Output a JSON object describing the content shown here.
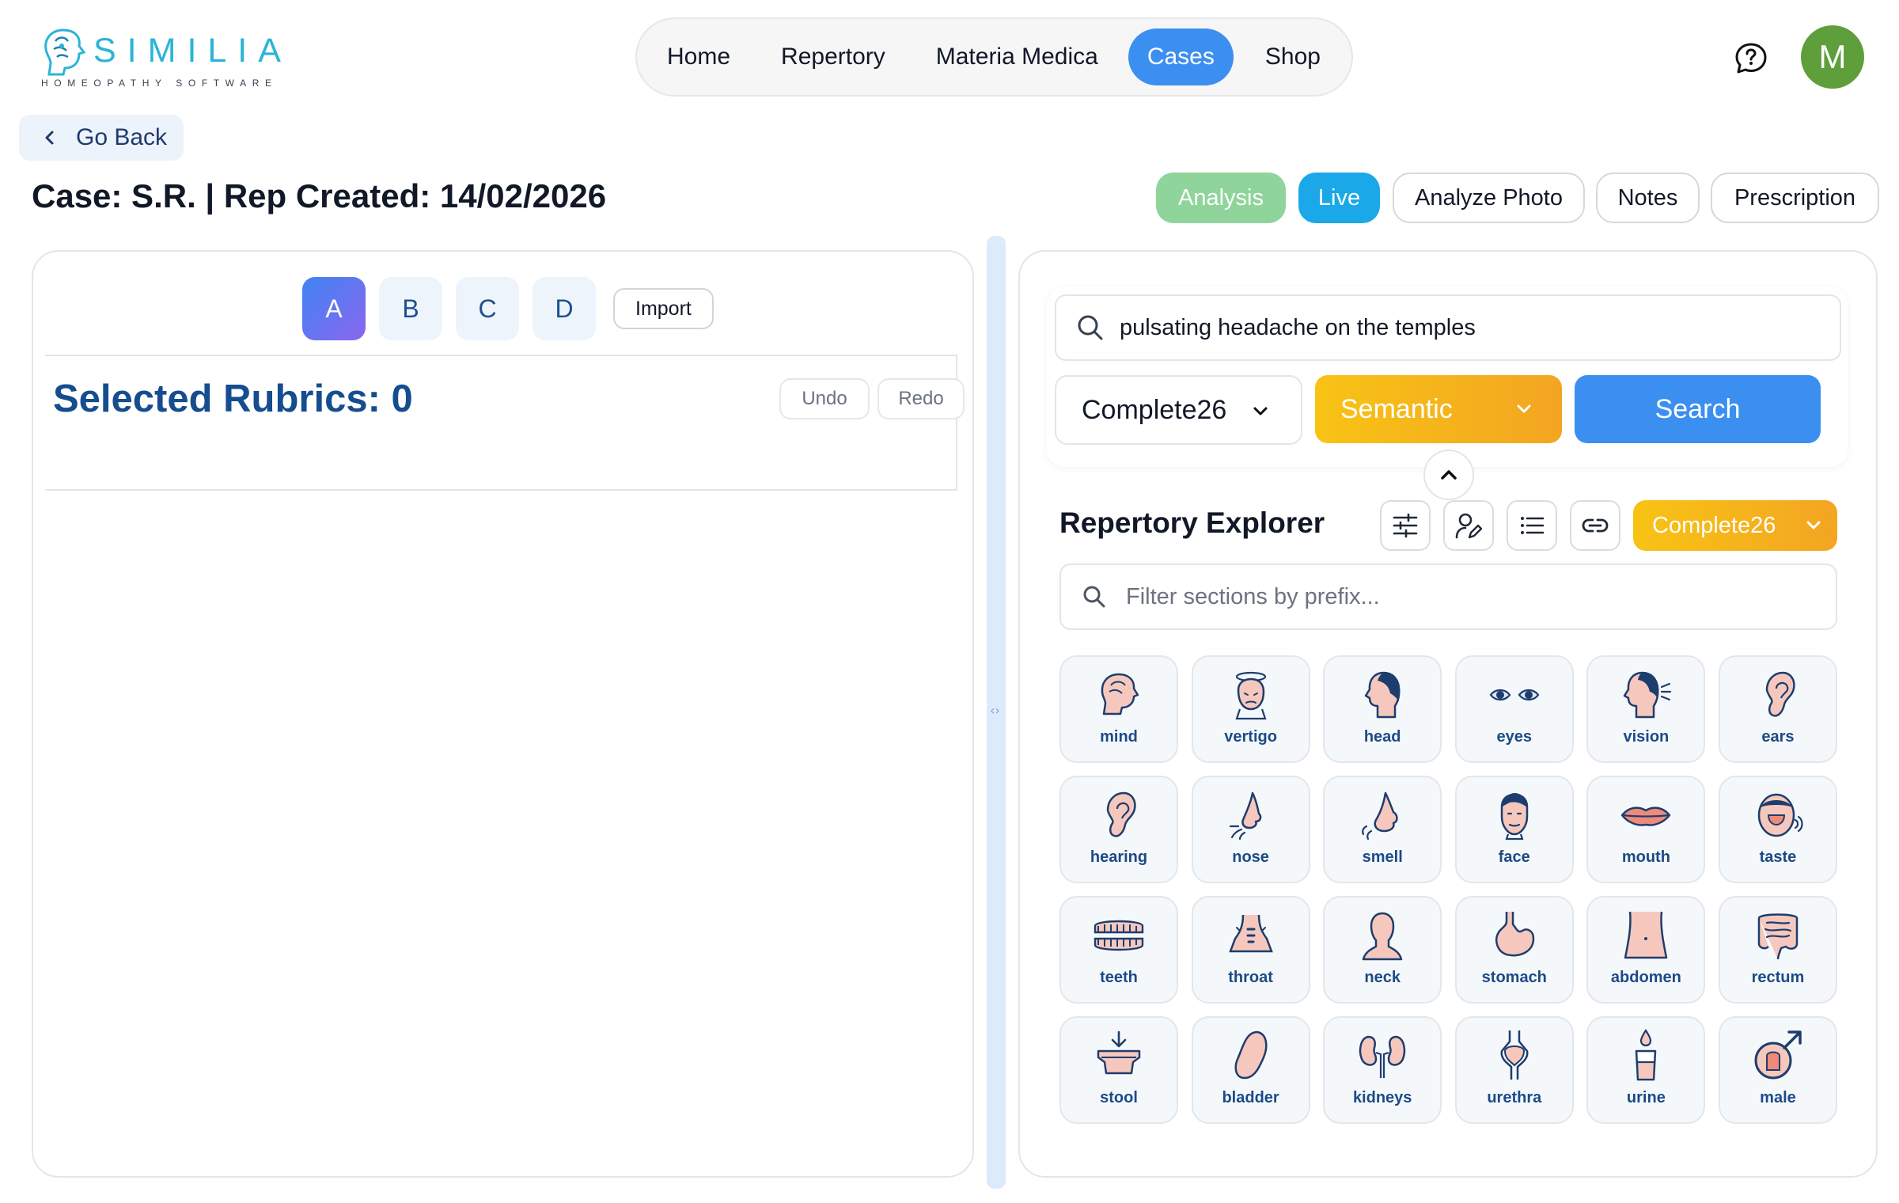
{
  "brand": {
    "name": "SIMILIA",
    "tagline": "HOMEOPATHY SOFTWARE"
  },
  "nav": {
    "items": [
      {
        "label": "Home",
        "active": false
      },
      {
        "label": "Repertory",
        "active": false
      },
      {
        "label": "Materia Medica",
        "active": false
      },
      {
        "label": "Cases",
        "active": true
      },
      {
        "label": "Shop",
        "active": false
      }
    ]
  },
  "user": {
    "initial": "M",
    "avatar_color": "#5e9e3b"
  },
  "go_back": "Go Back",
  "case_title": "Case: S.R. | Rep Created: 14/02/2026",
  "actions": {
    "analysis": "Analysis",
    "live": "Live",
    "analyze_photo": "Analyze Photo",
    "notes": "Notes",
    "prescription": "Prescription"
  },
  "left": {
    "tabs": [
      "A",
      "B",
      "C",
      "D"
    ],
    "active_tab": "A",
    "import_label": "Import",
    "rubrics_title": "Selected Rubrics: 0",
    "undo": "Undo",
    "redo": "Redo"
  },
  "search": {
    "query": "pulsating headache on the temples",
    "repertory": "Complete26",
    "mode": "Semantic",
    "button": "Search"
  },
  "explorer": {
    "title": "Repertory Explorer",
    "repertory": "Complete26",
    "filter_placeholder": "Filter sections by prefix...",
    "sections": [
      "mind",
      "vertigo",
      "head",
      "eyes",
      "vision",
      "ears",
      "hearing",
      "nose",
      "smell",
      "face",
      "mouth",
      "taste",
      "teeth",
      "throat",
      "neck",
      "stomach",
      "abdomen",
      "rectum",
      "stool",
      "bladder",
      "kidneys",
      "urethra",
      "urine",
      "male"
    ]
  },
  "colors": {
    "accent": "#3b8ff0",
    "brand": "#2bb4d6",
    "section_label": "#1c4a86",
    "icon_skin": "#f6c8bd",
    "icon_stroke": "#1d3d6e"
  }
}
